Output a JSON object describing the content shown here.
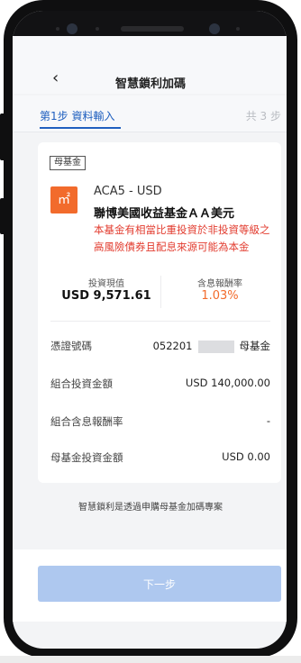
{
  "header": {
    "back_icon": "‹",
    "title": "智慧鎖利加碼"
  },
  "steps": {
    "current": "第1步 資料輸入",
    "total": "共 3 步"
  },
  "card": {
    "tag": "母基金",
    "fund_icon_glyph": "㎡",
    "fund_code": "ACA5 - USD",
    "fund_name": "聯博美國收益基金ＡＡ美元",
    "warning": "本基金有相當比重投資於非投資等級之高風險債券且配息來源可能為本金",
    "investment_value_label": "投資現值",
    "investment_value": "USD 9,571.61",
    "return_label": "含息報酬率",
    "return_value": "1.03%",
    "rows": [
      {
        "label": "憑證號碼",
        "value_prefix": "052201",
        "value_suffix": "母基金"
      },
      {
        "label": "組合投資金額",
        "value": "USD 140,000.00"
      },
      {
        "label": "組合含息報酬率",
        "value": "-"
      },
      {
        "label": "母基金投資金額",
        "value": "USD 0.00"
      }
    ]
  },
  "note": "智慧鎖利是透過申購母基金加碼專案",
  "next_button": "下一步",
  "colors": {
    "accent": "#1f5fbf",
    "warning": "#e23b2e",
    "fund_icon": "#f26b2c",
    "button_disabled": "#aec8ef"
  }
}
